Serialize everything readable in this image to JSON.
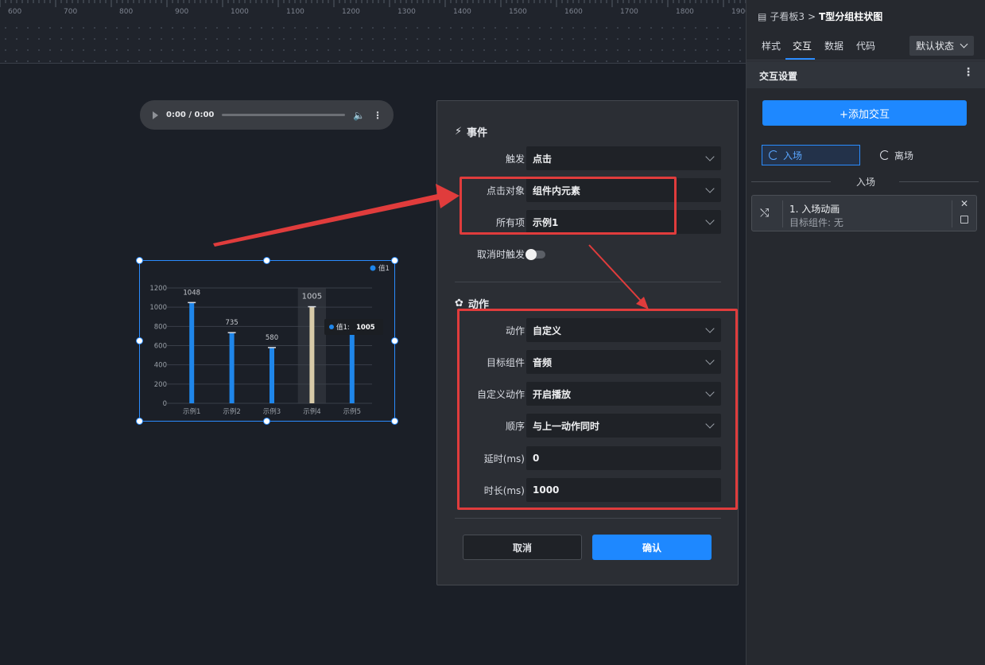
{
  "ruler": {
    "labels": [
      "600",
      "700",
      "800",
      "900",
      "1000",
      "1100",
      "1200",
      "1300",
      "1400",
      "1500",
      "1600",
      "1700",
      "1800",
      "1900"
    ]
  },
  "audio": {
    "time": "0:00 / 0:00",
    "icons": {
      "play": "play-icon",
      "volume": "volume-icon",
      "more": "more-vertical-icon"
    }
  },
  "chart_data": {
    "type": "bar",
    "categories": [
      "示例1",
      "示例2",
      "示例3",
      "示例4",
      "示例5"
    ],
    "series": [
      {
        "name": "值1",
        "values": [
          1048,
          735,
          580,
          1005,
          735
        ]
      }
    ],
    "data_labels": [
      "1048",
      "735",
      "580",
      "1005",
      ""
    ],
    "ylim": [
      0,
      1200
    ],
    "yticks": [
      "0",
      "200",
      "400",
      "600",
      "800",
      "1000",
      "1200"
    ],
    "grid": true,
    "legend": "top-right",
    "highlight_index": 3,
    "tooltip": {
      "label": "值1:",
      "value": "1005"
    },
    "colors": {
      "bar": "#1f86ea",
      "highlight": "#d7caa8",
      "grid": "#3a3f49"
    }
  },
  "modal": {
    "event_title": "事件",
    "action_title": "动作",
    "rows_event": [
      {
        "label": "触发",
        "value": "点击"
      },
      {
        "label": "点击对象",
        "value": "组件内元素"
      },
      {
        "label": "所有项",
        "value": "示例1"
      }
    ],
    "cancel_trigger_label": "取消时触发",
    "rows_action": [
      {
        "label": "动作",
        "value": "自定义"
      },
      {
        "label": "目标组件",
        "value": "音频"
      },
      {
        "label": "自定义动作",
        "value": "开启播放"
      },
      {
        "label": "顺序",
        "value": "与上一动作同时"
      },
      {
        "label": "延时(ms)",
        "value": "0"
      },
      {
        "label": "时长(ms)",
        "value": "1000"
      }
    ],
    "cancel": "取消",
    "confirm": "确认"
  },
  "panel": {
    "breadcrumb_parent": "子看板3",
    "breadcrumb_sep": ">",
    "breadcrumb_current": "T型分组柱状图",
    "tabs": [
      "样式",
      "交互",
      "数据",
      "代码"
    ],
    "state": "默认状态",
    "section": "交互设置",
    "add_button": "+添加交互",
    "enter": "入场",
    "exit": "离场",
    "group": "入场",
    "card_title": "1. 入场动画",
    "card_sub": "目标组件: 无"
  },
  "colors": {
    "accent": "#1e88ff",
    "highlight_red": "#e03c3c"
  }
}
